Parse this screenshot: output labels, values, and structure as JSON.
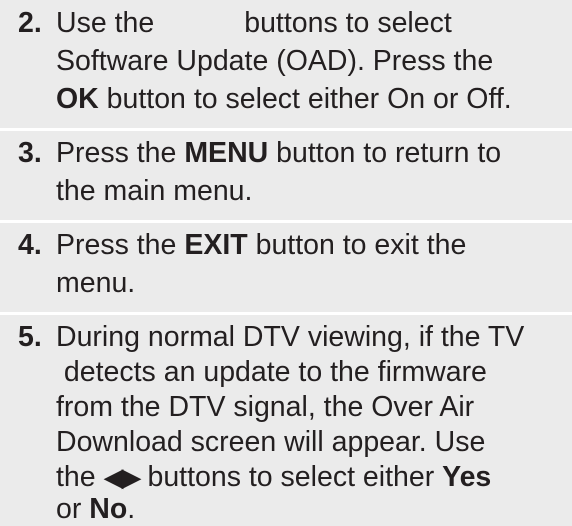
{
  "steps": [
    {
      "number": "2.",
      "lines": [
        {
          "a": "Use the",
          "b": "buttons to select"
        },
        {
          "text": "Software Update (OAD). Press the"
        },
        {
          "bold": "OK",
          "rest": " button to select either On or Off."
        }
      ]
    },
    {
      "number": "3.",
      "lines": [
        {
          "pre": "Press the ",
          "bold": "MENU",
          "rest": " button to return to"
        },
        {
          "text": "the main menu."
        }
      ]
    },
    {
      "number": "4.",
      "lines": [
        {
          "pre": "Press the ",
          "bold": "EXIT",
          "rest": " button to exit the"
        },
        {
          "text": "menu."
        }
      ]
    },
    {
      "number": "5.",
      "lines": [
        {
          "text": "During normal DTV viewing, if the TV"
        },
        {
          "text": " detects an update to the firmware"
        },
        {
          "text": "from the DTV signal, the Over Air"
        },
        {
          "text": "Download screen will appear. Use"
        },
        {
          "pre": "the ",
          "arrows": "◀▶",
          "mid": " buttons to select either ",
          "bold": "Yes"
        },
        {
          "pre": "or ",
          "bold": "No",
          "rest": "."
        }
      ]
    }
  ]
}
